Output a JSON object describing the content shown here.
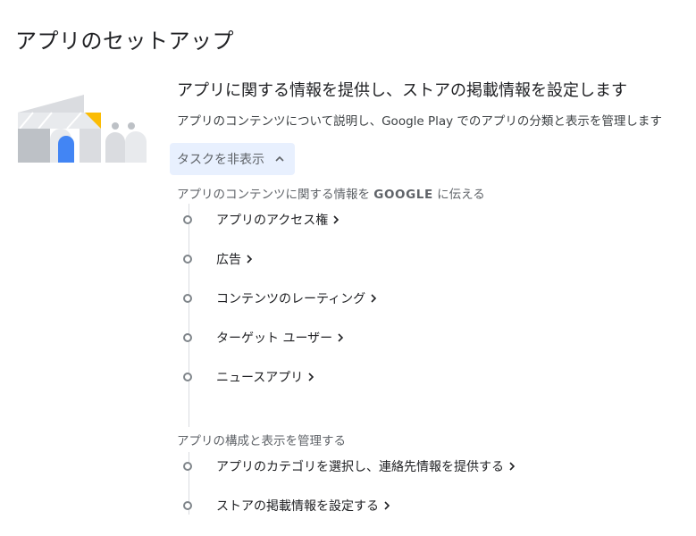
{
  "page": {
    "title": "アプリのセットアップ"
  },
  "section": {
    "heading": "アプリに関する情報を提供し、ストアの掲載情報を設定します",
    "description": "アプリのコンテンツについて説明し、Google Play でのアプリの分類と表示を管理します",
    "toggle_label": "タスクを非表示"
  },
  "groups": [
    {
      "label_prefix": "アプリのコンテンツに関する情報を ",
      "label_strong": "GOOGLE",
      "label_suffix": " に伝える",
      "tasks": [
        {
          "label": "アプリのアクセス権"
        },
        {
          "label": "広告"
        },
        {
          "label": "コンテンツのレーティング"
        },
        {
          "label": "ターゲット ユーザー"
        },
        {
          "label": "ニュースアプリ"
        }
      ]
    },
    {
      "label": "アプリの構成と表示を管理する",
      "tasks": [
        {
          "label": "アプリのカテゴリを選択し、連絡先情報を提供する"
        },
        {
          "label": "ストアの掲載情報を設定する"
        }
      ]
    }
  ],
  "colors": {
    "accent_blue": "#4285f4",
    "accent_yellow": "#fbbc04",
    "toggle_bg": "#e8f0fe",
    "timeline": "#dadce0"
  },
  "icons": {
    "toggle": "chevron-up-icon",
    "task_link": "chevron-right-icon",
    "task_marker": "circle-outline-icon"
  }
}
